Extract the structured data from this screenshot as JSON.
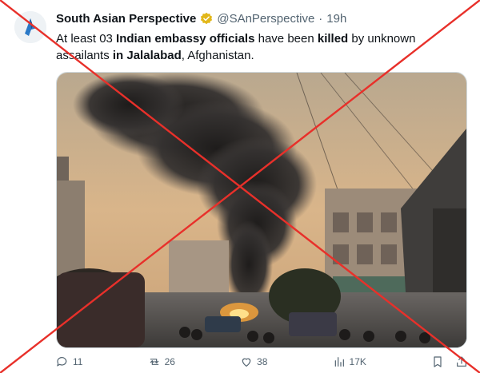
{
  "tweet": {
    "author_name": "South Asian Perspective",
    "handle": "@SAnPerspective",
    "separator": "·",
    "time": "19h",
    "text_parts": [
      {
        "t": "At least 03 ",
        "b": false
      },
      {
        "t": "Indian embassy officials",
        "b": true
      },
      {
        "t": " have been ",
        "b": false
      },
      {
        "t": "killed",
        "b": true
      },
      {
        "t": " by unknown assailants ",
        "b": false
      },
      {
        "t": "in Jalalabad",
        "b": true
      },
      {
        "t": ", Afghanistan.",
        "b": false
      }
    ],
    "image_icon": "photo-of-smoke-plume-over-street"
  },
  "actions": {
    "reply_count": "11",
    "retweet_count": "26",
    "like_count": "38",
    "views_count": "17K"
  },
  "icons": {
    "reply": "speech-bubble-icon",
    "retweet": "retweet-arrows-icon",
    "like": "heart-icon",
    "views": "bar-chart-icon",
    "bookmark": "bookmark-icon",
    "share": "share-icon",
    "verified": "gold-check-badge-icon"
  },
  "colors": {
    "fact_check_cross": "#e8302a",
    "verified_badge": "#e2b719",
    "text_secondary": "#536471"
  }
}
